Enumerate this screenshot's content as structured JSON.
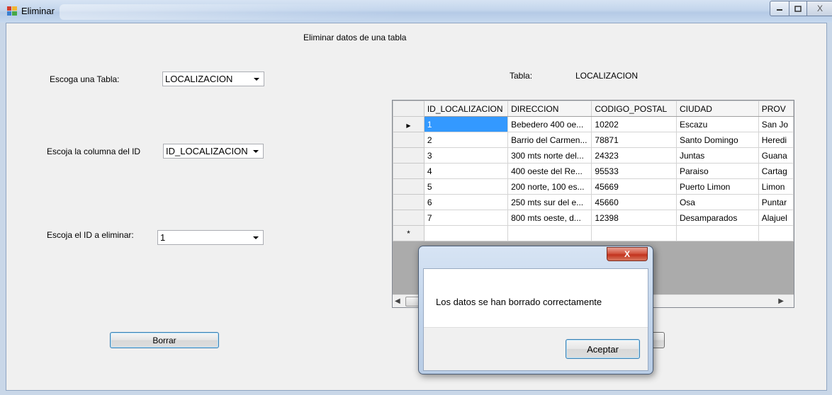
{
  "window": {
    "title": "Eliminar",
    "close_glyph": "X"
  },
  "form": {
    "heading": "Eliminar datos de una tabla",
    "table_label": "Escoga una Tabla:",
    "table_value": "LOCALIZACION",
    "column_label": "Escoja la columna del ID",
    "column_value": "ID_LOCALIZACION",
    "id_label": "Escoja el  ID a eliminar:",
    "id_value": "1",
    "delete_button": "Borrar",
    "tabla_label": "Tabla:",
    "tabla_value": "LOCALIZACION"
  },
  "grid": {
    "columns": [
      "ID_LOCALIZACION",
      "DIRECCION",
      "CODIGO_POSTAL",
      "CIUDAD",
      "PROV"
    ],
    "rows": [
      [
        "1",
        "Bebedero 400 oe...",
        "10202",
        "Escazu",
        "San Jo"
      ],
      [
        "2",
        "Barrio del Carmen...",
        "78871",
        "Santo Domingo",
        "Heredi"
      ],
      [
        "3",
        "300 mts norte del...",
        "24323",
        "Juntas",
        "Guana"
      ],
      [
        "4",
        "400 oeste del Re...",
        "95533",
        "Paraiso",
        "Cartag"
      ],
      [
        "5",
        "200 norte, 100 es...",
        "45669",
        "Puerto Limon",
        "Limon"
      ],
      [
        "6",
        "250 mts sur del e...",
        "45660",
        "Osa",
        "Puntar"
      ],
      [
        "7",
        "800 mts oeste, d...",
        "12398",
        "Desamparados",
        "Alajuel"
      ]
    ],
    "current_row_marker": "▶",
    "new_row_marker": "*"
  },
  "dialog": {
    "message": "Los datos se han borrado correctamente",
    "ok_button": "Aceptar",
    "close_glyph": "X"
  }
}
